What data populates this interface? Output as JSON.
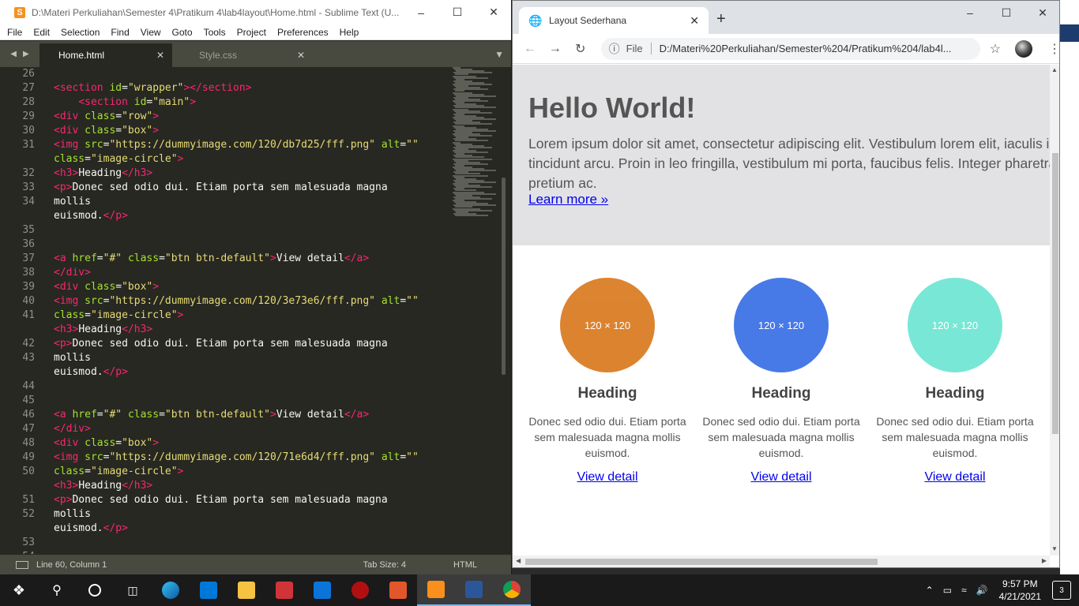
{
  "sublime": {
    "title": "D:\\Materi Perkuliahan\\Semester 4\\Pratikum 4\\lab4layout\\Home.html - Sublime Text (U...",
    "menu": [
      "File",
      "Edit",
      "Selection",
      "Find",
      "View",
      "Goto",
      "Tools",
      "Project",
      "Preferences",
      "Help"
    ],
    "tabs": [
      {
        "label": "Home.html",
        "active": true
      },
      {
        "label": "Style.css",
        "active": false
      }
    ],
    "line_numbers": [
      "26",
      "27",
      "28",
      "29",
      "30",
      "31",
      "",
      "32",
      "33",
      "34",
      "",
      "35",
      "36",
      "37",
      "38",
      "39",
      "40",
      "41",
      "",
      "42",
      "43",
      "",
      "44",
      "45",
      "46",
      "47",
      "48",
      "49",
      "50",
      "",
      "51",
      "52",
      "",
      "53",
      "54"
    ],
    "code_lines": [
      {
        "ln": "26",
        "text": ""
      },
      {
        "ln": "27",
        "text": "<section id=\"wrapper\"></section>"
      },
      {
        "ln": "28",
        "text": "    <section id=\"main\">"
      },
      {
        "ln": "29",
        "text": "<div class=\"row\">"
      },
      {
        "ln": "30",
        "text": "<div class=\"box\">"
      },
      {
        "ln": "31",
        "text": "<img src=\"https://dummyimage.com/120/db7d25/fff.png\" alt=\"\""
      },
      {
        "ln": "",
        "text": "class=\"image-circle\">"
      },
      {
        "ln": "32",
        "text": "<h3>Heading</h3>"
      },
      {
        "ln": "33",
        "text": "<h3>Heading</h3>"
      },
      {
        "ln": "34",
        "text": "<p>Donec sed odio dui. Etiam porta sem malesuada magna"
      },
      {
        "ln": "",
        "text": "mollis"
      },
      {
        "ln": "35",
        "text": "euismod.</p>"
      }
    ],
    "status": {
      "position": "Line 60, Column 1",
      "tab_size": "Tab Size: 4",
      "syntax": "HTML"
    }
  },
  "chrome": {
    "tab_title": "Layout Sederhana",
    "omnibox": {
      "scheme_label": "File",
      "url": "D:/Materi%20Perkuliahan/Semester%204/Pratikum%204/lab4l..."
    },
    "page": {
      "heading": "Hello World!",
      "lead": "Lorem ipsum dolor sit amet, consectetur adipiscing elit. Vestibulum lorem elit, iaculis in tincidunt arcu. Proin in leo fringilla, vestibulum mi porta, faucibus felis. Integer pharetra pretium ac.",
      "learn_more": "Learn more »",
      "boxes": [
        {
          "image_text": "120 × 120",
          "color": "#db7d25",
          "heading": "Heading",
          "text": "Donec sed odio dui. Etiam porta sem malesuada magna mollis euismod.",
          "link": "View detail"
        },
        {
          "image_text": "120 × 120",
          "color": "#3e73e6",
          "heading": "Heading",
          "text": "Donec sed odio dui. Etiam porta sem malesuada magna mollis euismod.",
          "link": "View detail"
        },
        {
          "image_text": "120 × 120",
          "color": "#71e6d4",
          "heading": "Heading",
          "text": "Donec sed odio dui. Etiam porta sem malesuada magna mollis euismod.",
          "link": "View detail"
        }
      ]
    }
  },
  "taskbar": {
    "apps": [
      "start-icon",
      "search-icon",
      "cortana-icon",
      "task-view-icon",
      "edge-icon",
      "store-icon",
      "file-explorer-icon",
      "gift-icon",
      "mail-icon",
      "game-icon",
      "pdf-icon",
      "sublime-icon",
      "word-icon",
      "chrome-icon"
    ],
    "time": "9:57 PM",
    "date": "4/21/2021",
    "notifications": "3"
  }
}
